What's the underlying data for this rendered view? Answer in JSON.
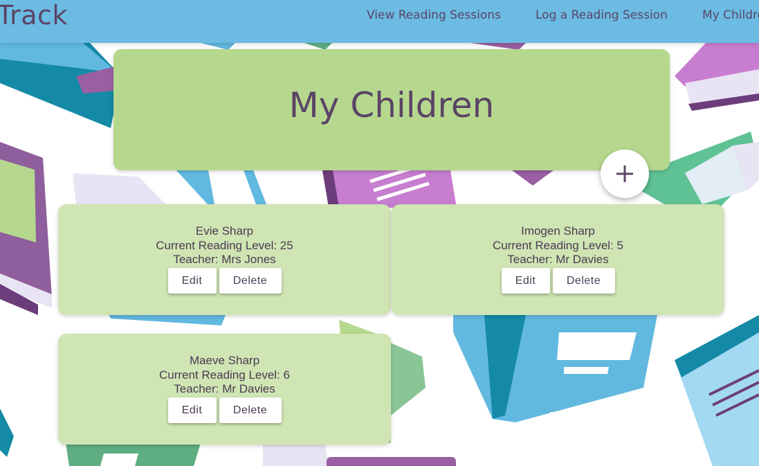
{
  "nav": {
    "brand": "Track",
    "links": [
      "View Reading Sessions",
      "Log a Reading Session",
      "My Children"
    ]
  },
  "page": {
    "title": "My Children"
  },
  "children": [
    {
      "name": "Evie Sharp",
      "level": "Current Reading Level: 25",
      "teacher": "Teacher: Mrs Jones",
      "edit_label": "Edit",
      "delete_label": "Delete"
    },
    {
      "name": "Imogen Sharp",
      "level": "Current Reading Level: 5",
      "teacher": "Teacher: Mr Davies",
      "edit_label": "Edit",
      "delete_label": "Delete"
    },
    {
      "name": "Maeve Sharp",
      "level": "Current Reading Level: 6",
      "teacher": "Teacher: Mr Davies",
      "edit_label": "Edit",
      "delete_label": "Delete"
    }
  ],
  "colors": {
    "navbar": "#6bbbe3",
    "title_card": "#b6d88e",
    "child_card": "#cfe5b3",
    "text": "#5a4466",
    "accent_purple": "#9a5fa3"
  },
  "icons": {
    "add": "plus-icon"
  }
}
